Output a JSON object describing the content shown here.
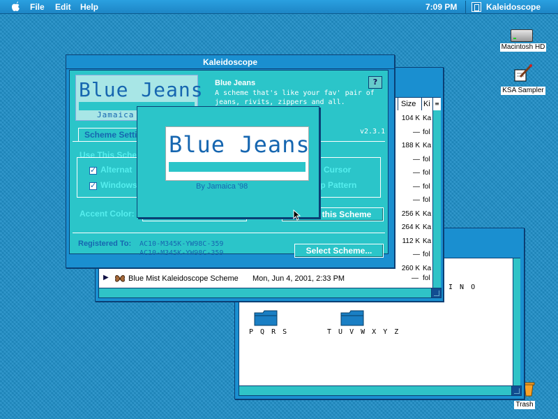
{
  "menubar": {
    "items": [
      "File",
      "Edit",
      "Help"
    ],
    "clock": "7:09 PM",
    "app_name": "Kaleidoscope"
  },
  "desktop": {
    "icons": [
      {
        "label": "Macintosh HD",
        "icon": "hard-drive-icon"
      },
      {
        "label": "KSA Sampler",
        "icon": "document-pen-icon"
      },
      {
        "label": "Trash",
        "icon": "trash-icon"
      }
    ]
  },
  "folder_window": {
    "folders": [
      {
        "label": "P Q R S"
      },
      {
        "label": "T U V W X Y Z"
      }
    ],
    "partial_label": "I N O"
  },
  "list_window": {
    "columns": [
      "Size",
      "Ki"
    ],
    "rows": [
      {
        "size": "104 K",
        "kind": "Ka"
      },
      {
        "size": "—",
        "kind": "fol"
      },
      {
        "size": "188 K",
        "kind": "Ka"
      },
      {
        "size": "—",
        "kind": "fol"
      },
      {
        "size": "—",
        "kind": "fol"
      },
      {
        "size": "—",
        "kind": "fol"
      },
      {
        "size": "—",
        "kind": "fol"
      },
      {
        "size": "256 K",
        "kind": "Ka"
      },
      {
        "size": "264 K",
        "kind": "Ka"
      },
      {
        "size": "112 K",
        "kind": "Ka"
      },
      {
        "size": "—",
        "kind": "fol"
      },
      {
        "size": "260 K",
        "kind": "Ka"
      }
    ],
    "bottom_row": {
      "name": "Blue Mist Kaleidoscope Scheme",
      "date": "Mon, Jun 4, 2001, 2:33 PM",
      "size": "—",
      "kind": "fol"
    }
  },
  "kaleidoscope": {
    "title": "Kaleidoscope",
    "logo_text": "Blue Jeans",
    "logo_sub": "Jamaica",
    "scheme_name": "Blue Jeans",
    "scheme_desc_1": "A scheme that's like your fav' pair of",
    "scheme_desc_2": "jeans, rivits, zippers and all.",
    "help_label": "?",
    "version": "v2.3.1",
    "tab_label": "Scheme Setti",
    "group_label": "Use This Sche",
    "check1_label": "Alternat",
    "check2_label": "Windows",
    "cursor_label": "Cursor",
    "pattern_label": "op Pattern",
    "accent_label": "Accent Color:",
    "use_scheme_label": "this Scheme",
    "registered_label": "Registered To:",
    "reg_code_1": "AC10-M345K-YW98C-359",
    "reg_code_2": "AC10-M345K-YW98C-359",
    "select_label": "Select Scheme..."
  },
  "preview": {
    "logo_text": "Blue Jeans",
    "byline": "By Jamaica '98"
  },
  "colors": {
    "desktop": "#1f8fc8",
    "window_frame": "#1a8fd0",
    "teal": "#2bc5c9",
    "dark_blue": "#1666b0"
  }
}
